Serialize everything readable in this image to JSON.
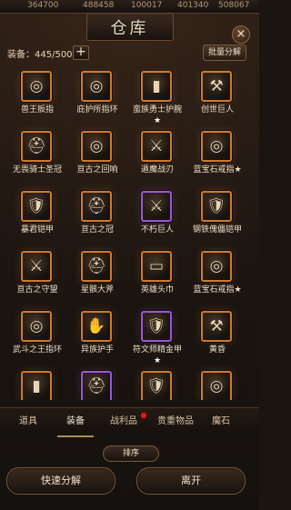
{
  "topbar": {
    "stats": [
      "364700",
      "488458",
      "100017",
      "401340",
      "508067"
    ]
  },
  "window": {
    "title": "仓库",
    "close_label": "×"
  },
  "header": {
    "capacity_text": "装备：445/500",
    "add_label": "+",
    "batch_decompose_label": "批量分解"
  },
  "items": [
    {
      "name": "兽王扳指",
      "star": "",
      "rarity": "orange",
      "icon": "ring-icon"
    },
    {
      "name": "庇护所指环",
      "star": "",
      "rarity": "orange",
      "icon": "ring-icon"
    },
    {
      "name": "蛮族勇士护腕",
      "star": "★",
      "rarity": "orange",
      "icon": "bracer-icon"
    },
    {
      "name": "创世巨人",
      "star": "",
      "rarity": "orange",
      "icon": "axe-icon"
    },
    {
      "name": "无畏骑士圣冠",
      "star": "",
      "rarity": "orange",
      "icon": "helmet-icon"
    },
    {
      "name": "亘古之回响",
      "star": "",
      "rarity": "orange",
      "icon": "ring-icon"
    },
    {
      "name": "遁魔战刃",
      "star": "",
      "rarity": "orange",
      "icon": "sword-icon"
    },
    {
      "name": "蓝宝石戒指★",
      "star": "",
      "rarity": "orange",
      "icon": "ring-icon"
    },
    {
      "name": "暴君铠甲",
      "star": "",
      "rarity": "orange",
      "icon": "armor-icon"
    },
    {
      "name": "亘古之冠",
      "star": "",
      "rarity": "orange",
      "icon": "helmet-icon"
    },
    {
      "name": "不朽巨人",
      "star": "",
      "rarity": "purple",
      "icon": "sword-icon"
    },
    {
      "name": "钢铁傀儡铠甲",
      "star": "",
      "rarity": "orange",
      "icon": "armor-icon"
    },
    {
      "name": "亘古之守望",
      "star": "",
      "rarity": "orange",
      "icon": "sword-icon"
    },
    {
      "name": "星骸大斧",
      "star": "",
      "rarity": "orange",
      "icon": "helmet-icon"
    },
    {
      "name": "英雄头巾",
      "star": "",
      "rarity": "orange",
      "icon": "headband-icon"
    },
    {
      "name": "蓝宝石戒指★",
      "star": "",
      "rarity": "orange",
      "icon": "ring-icon"
    },
    {
      "name": "武斗之王指环",
      "star": "",
      "rarity": "orange",
      "icon": "ring-icon"
    },
    {
      "name": "异族护手",
      "star": "",
      "rarity": "orange",
      "icon": "gauntlet-icon"
    },
    {
      "name": "符文师精金甲",
      "star": "★",
      "rarity": "purple",
      "icon": "armor-icon"
    },
    {
      "name": "黄昏",
      "star": "",
      "rarity": "orange",
      "icon": "axe-icon"
    },
    {
      "name": "",
      "star": "",
      "rarity": "orange",
      "icon": "bracer-icon"
    },
    {
      "name": "",
      "star": "",
      "rarity": "purple",
      "icon": "helmet-icon"
    },
    {
      "name": "",
      "star": "",
      "rarity": "orange",
      "icon": "armor-icon"
    },
    {
      "name": "",
      "star": "",
      "rarity": "orange",
      "icon": "ring-icon"
    }
  ],
  "tabs": [
    {
      "label": "道具"
    },
    {
      "label": "装备"
    },
    {
      "label": "战利品"
    },
    {
      "label": "贵重物品"
    },
    {
      "label": "魔石"
    }
  ],
  "buttons": {
    "sort_label": "排序",
    "quick_decompose_label": "快速分解",
    "leave_label": "离开"
  }
}
